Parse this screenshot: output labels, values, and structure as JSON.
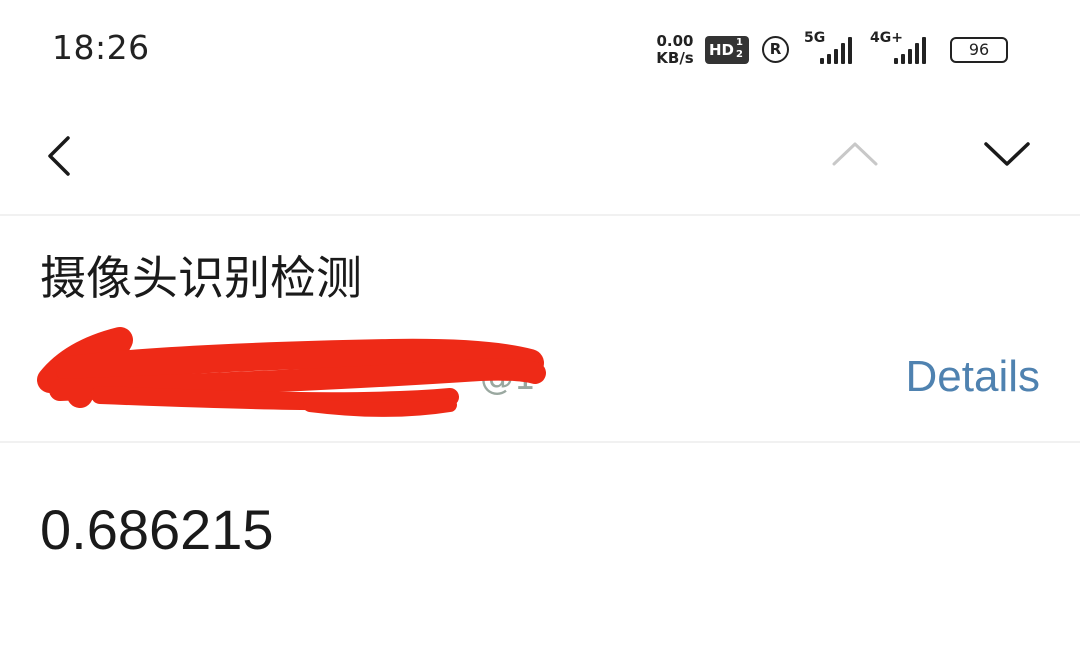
{
  "status_bar": {
    "time": "18:26",
    "net_speed_value": "0.00",
    "net_speed_unit": "KB/s",
    "hd_label": "HD",
    "hd_sub": "1\n2",
    "roaming_label": "R",
    "sim1_network": "5G",
    "sim2_network": "4G+",
    "battery_level": "96",
    "battery_fraction": 0.96
  },
  "nav": {
    "back_icon": "chevron-left-icon",
    "prev_icon": "chevron-up-icon",
    "next_icon": "chevron-down-icon"
  },
  "message": {
    "title": "摄像头识别检测",
    "sender_visible_fragment": "@1",
    "details_label": "Details",
    "body": "0.686215"
  },
  "colors": {
    "link": "#4f82b0",
    "redaction": "#ee2a17",
    "disabled_icon": "#c8c8c8"
  }
}
